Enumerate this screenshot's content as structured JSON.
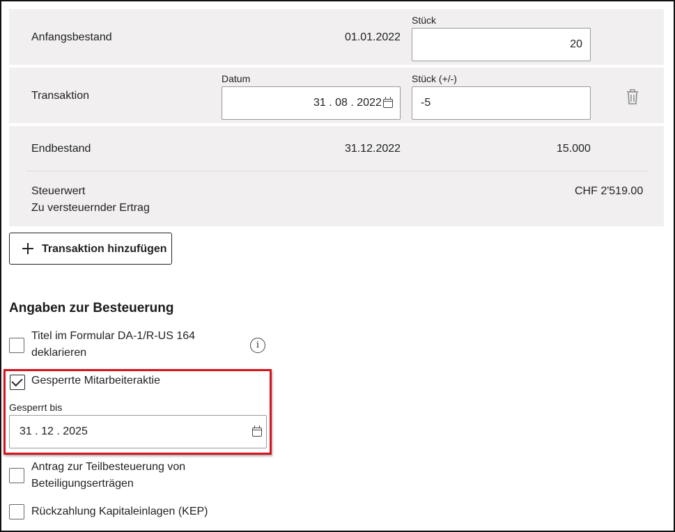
{
  "panel1": {
    "label": "Anfangsbestand",
    "date": "01.01.2022",
    "qty_label": "Stück",
    "qty_value": "20"
  },
  "panel2": {
    "label": "Transaktion",
    "date_label": "Datum",
    "date_value": "31 . 08 . 2022",
    "qty_label": "Stück (+/-)",
    "qty_value": "-5"
  },
  "panel3": {
    "label": "Endbestand",
    "date": "31.12.2022",
    "qty": "15.000",
    "tax_value_label": "Steuerwert",
    "taxable_income_label": "Zu versteuernder Ertrag",
    "tax_value": "CHF 2'519.00"
  },
  "add_button_label": "Transaktion hinzufügen",
  "taxation": {
    "title": "Angaben zur Besteuerung",
    "opt1_line1": "Titel im Formular DA-1/R-US 164",
    "opt1_line2": "deklarieren",
    "info_glyph": "i",
    "opt2_label": "Gesperrte Mitarbeiteraktie",
    "locked_until_label": "Gesperrt bis",
    "locked_until_value": "31 . 12 . 2025",
    "opt3_line1": "Antrag zur Teilbesteuerung von",
    "opt3_line2": "Beteiligungserträgen",
    "opt4_label": "Rückzahlung Kapitaleinlagen (KEP)"
  },
  "checkboxes": {
    "opt1": false,
    "opt2": true,
    "opt3": false,
    "opt4": false
  },
  "colors": {
    "panel_bg": "#f1efef",
    "highlight": "#d6141c"
  },
  "icons": {
    "calendar": "calendar-icon",
    "trash": "trash-icon",
    "plus": "plus-icon",
    "info": "info-icon",
    "check": "checkmark-icon"
  }
}
